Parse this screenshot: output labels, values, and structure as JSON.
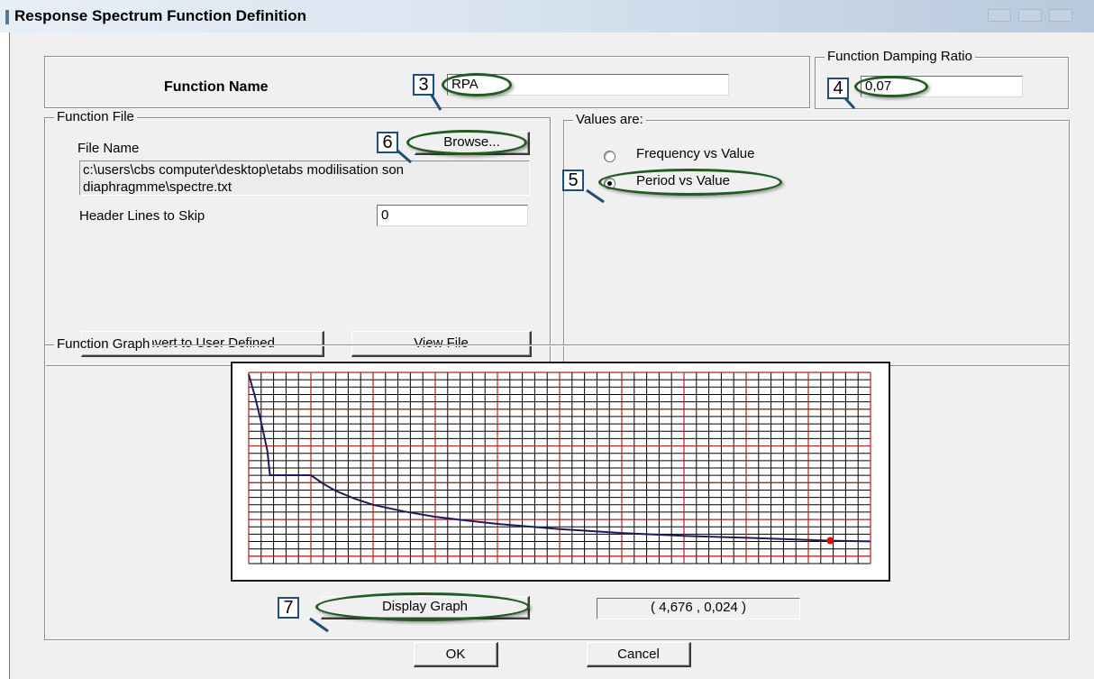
{
  "window": {
    "title": "Response Spectrum  Function Definition"
  },
  "function_name": {
    "label": "Function Name",
    "value": "RPA"
  },
  "damping": {
    "legend": "Function Damping Ratio",
    "value": "0,07"
  },
  "function_file": {
    "legend": "Function File",
    "file_name_label": "File Name",
    "browse_label": "Browse...",
    "file_path": "c:\\users\\cbs computer\\desktop\\etabs modilisation son diaphragmme\\spectre.txt",
    "header_lines_label": "Header Lines to Skip",
    "header_lines_value": "0",
    "convert_label": "Convert to User Defined",
    "view_file_label": "View File"
  },
  "values_are": {
    "legend": "Values are:",
    "options": [
      {
        "label": "Frequency vs Value",
        "selected": false
      },
      {
        "label": "Period vs Value",
        "selected": true
      }
    ]
  },
  "function_graph": {
    "legend": "Function Graph",
    "display_graph_label": "Display Graph",
    "coordinate_readout": "( 4,676  ,  0,024 )"
  },
  "buttons": {
    "ok": "OK",
    "cancel": "Cancel"
  },
  "callouts": [
    "3",
    "4",
    "5",
    "6",
    "7"
  ],
  "colors": {
    "curve": "#1c1c5a",
    "major_grid": "#b22222",
    "minor_grid": "#000000",
    "marker": "#d01010",
    "callout_ellipse": "#1f5c1f",
    "callout_box": "#1f4e7a"
  },
  "chart_data": {
    "type": "line",
    "series": [
      {
        "points": [
          [
            0,
            0.198
          ],
          [
            0.05,
            0.175
          ],
          [
            0.1,
            0.148
          ],
          [
            0.15,
            0.118
          ],
          [
            0.17,
            0.093
          ],
          [
            0.17,
            0.0925
          ],
          [
            0.5,
            0.0925
          ],
          [
            0.6,
            0.0835
          ],
          [
            0.7,
            0.076
          ],
          [
            0.85,
            0.068
          ],
          [
            1.0,
            0.0615
          ],
          [
            1.25,
            0.0545
          ],
          [
            1.5,
            0.049
          ],
          [
            1.75,
            0.045
          ],
          [
            2.0,
            0.0415
          ],
          [
            2.5,
            0.036
          ],
          [
            3.0,
            0.032
          ],
          [
            3.5,
            0.029
          ],
          [
            4.0,
            0.027
          ],
          [
            4.676,
            0.024
          ],
          [
            5.0,
            0.0232
          ]
        ]
      }
    ],
    "marker": {
      "x": 4.676,
      "y": 0.024
    },
    "xlim": [
      0,
      5.0
    ],
    "ylim": [
      0,
      0.2
    ],
    "grid": true
  }
}
